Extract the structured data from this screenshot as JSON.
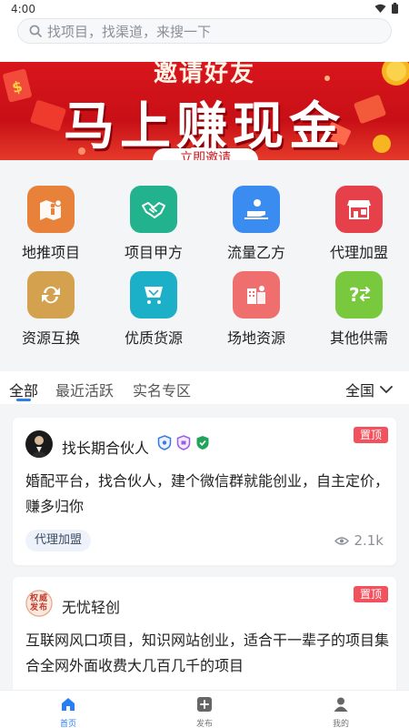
{
  "status": {
    "time": "4:00"
  },
  "search": {
    "placeholder": "找项目，找渠道，来搜一下"
  },
  "banner": {
    "subtitle": "邀请好友",
    "headline": "马上赚现金",
    "button": "立即邀请"
  },
  "categories": [
    {
      "label": "地推项目",
      "icon": "map-person-icon",
      "color": "#e8823a"
    },
    {
      "label": "项目甲方",
      "icon": "handshake-icon",
      "color": "#22b28e"
    },
    {
      "label": "流量乙方",
      "icon": "traffic-user-icon",
      "color": "#3b8cf0"
    },
    {
      "label": "代理加盟",
      "icon": "storefront-icon",
      "color": "#e6404a"
    },
    {
      "label": "资源互换",
      "icon": "exchange-icon",
      "color": "#d4a24e"
    },
    {
      "label": "优质货源",
      "icon": "diamond-cart-icon",
      "color": "#1cb0c8"
    },
    {
      "label": "场地资源",
      "icon": "venue-map-icon",
      "color": "#ef6f6f"
    },
    {
      "label": "其他供需",
      "icon": "question-arrows-icon",
      "color": "#78c93d"
    }
  ],
  "tabs": [
    {
      "label": "全部",
      "active": true
    },
    {
      "label": "最近活跃",
      "active": false
    },
    {
      "label": "实名专区",
      "active": false
    }
  ],
  "region": {
    "label": "全国"
  },
  "posts": [
    {
      "name": "找长期合伙人",
      "pinned": "置顶",
      "desc": "婚配平台，找合伙人，建个微信群就能创业，自主定价，赚多归你",
      "category": "代理加盟",
      "views": "2.1k"
    },
    {
      "name": "无忧轻创",
      "pinned": "置顶",
      "avatar_text": "权威发布",
      "desc": "互联网风口项目，知识网站创业，适合干一辈子的项目集合全网外面收费大几百几千的项目"
    }
  ],
  "nav": [
    {
      "label": "首页",
      "active": true
    },
    {
      "label": "发布",
      "active": false
    },
    {
      "label": "我的",
      "active": false
    }
  ]
}
